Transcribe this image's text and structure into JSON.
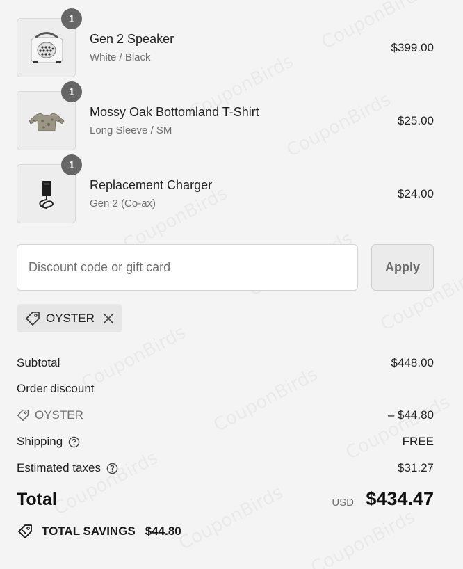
{
  "watermark": "CouponBirds",
  "items": [
    {
      "name": "Gen 2 Speaker",
      "variant": "White / Black",
      "price": "$399.00",
      "quantity": "1",
      "image": "speaker-image"
    },
    {
      "name": "Mossy Oak Bottomland T-Shirt",
      "variant": "Long Sleeve / SM",
      "price": "$25.00",
      "quantity": "1",
      "image": "t-shirt-image"
    },
    {
      "name": "Replacement Charger",
      "variant": "Gen 2 (Co-ax)",
      "price": "$24.00",
      "quantity": "1",
      "image": "charger-image"
    }
  ],
  "discount": {
    "placeholder": "Discount code or gift card",
    "apply_label": "Apply",
    "applied_code": "OYSTER"
  },
  "summary": {
    "subtotal_label": "Subtotal",
    "subtotal_value": "$448.00",
    "order_discount_label": "Order discount",
    "discount_code": "OYSTER",
    "discount_value": "– $44.80",
    "shipping_label": "Shipping",
    "shipping_value": "FREE",
    "taxes_label": "Estimated taxes",
    "taxes_value": "$31.27",
    "total_label": "Total",
    "currency": "USD",
    "total_value": "$434.47",
    "savings_label": "TOTAL SAVINGS",
    "savings_value": "$44.80"
  }
}
